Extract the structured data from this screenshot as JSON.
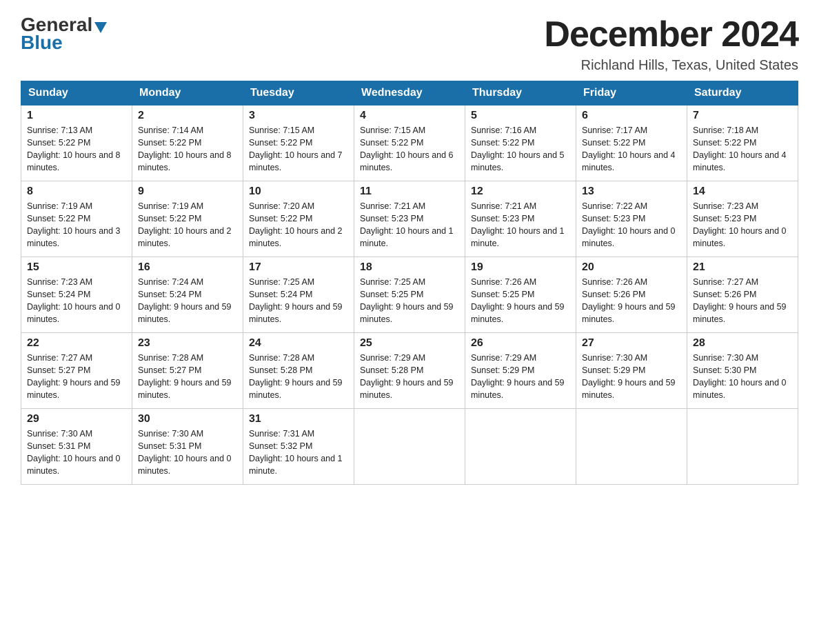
{
  "header": {
    "logo_general": "General",
    "logo_blue": "Blue",
    "title": "December 2024",
    "subtitle": "Richland Hills, Texas, United States"
  },
  "days_of_week": [
    "Sunday",
    "Monday",
    "Tuesday",
    "Wednesday",
    "Thursday",
    "Friday",
    "Saturday"
  ],
  "weeks": [
    [
      {
        "day": "1",
        "sunrise": "7:13 AM",
        "sunset": "5:22 PM",
        "daylight": "10 hours and 8 minutes."
      },
      {
        "day": "2",
        "sunrise": "7:14 AM",
        "sunset": "5:22 PM",
        "daylight": "10 hours and 8 minutes."
      },
      {
        "day": "3",
        "sunrise": "7:15 AM",
        "sunset": "5:22 PM",
        "daylight": "10 hours and 7 minutes."
      },
      {
        "day": "4",
        "sunrise": "7:15 AM",
        "sunset": "5:22 PM",
        "daylight": "10 hours and 6 minutes."
      },
      {
        "day": "5",
        "sunrise": "7:16 AM",
        "sunset": "5:22 PM",
        "daylight": "10 hours and 5 minutes."
      },
      {
        "day": "6",
        "sunrise": "7:17 AM",
        "sunset": "5:22 PM",
        "daylight": "10 hours and 4 minutes."
      },
      {
        "day": "7",
        "sunrise": "7:18 AM",
        "sunset": "5:22 PM",
        "daylight": "10 hours and 4 minutes."
      }
    ],
    [
      {
        "day": "8",
        "sunrise": "7:19 AM",
        "sunset": "5:22 PM",
        "daylight": "10 hours and 3 minutes."
      },
      {
        "day": "9",
        "sunrise": "7:19 AM",
        "sunset": "5:22 PM",
        "daylight": "10 hours and 2 minutes."
      },
      {
        "day": "10",
        "sunrise": "7:20 AM",
        "sunset": "5:22 PM",
        "daylight": "10 hours and 2 minutes."
      },
      {
        "day": "11",
        "sunrise": "7:21 AM",
        "sunset": "5:23 PM",
        "daylight": "10 hours and 1 minute."
      },
      {
        "day": "12",
        "sunrise": "7:21 AM",
        "sunset": "5:23 PM",
        "daylight": "10 hours and 1 minute."
      },
      {
        "day": "13",
        "sunrise": "7:22 AM",
        "sunset": "5:23 PM",
        "daylight": "10 hours and 0 minutes."
      },
      {
        "day": "14",
        "sunrise": "7:23 AM",
        "sunset": "5:23 PM",
        "daylight": "10 hours and 0 minutes."
      }
    ],
    [
      {
        "day": "15",
        "sunrise": "7:23 AM",
        "sunset": "5:24 PM",
        "daylight": "10 hours and 0 minutes."
      },
      {
        "day": "16",
        "sunrise": "7:24 AM",
        "sunset": "5:24 PM",
        "daylight": "9 hours and 59 minutes."
      },
      {
        "day": "17",
        "sunrise": "7:25 AM",
        "sunset": "5:24 PM",
        "daylight": "9 hours and 59 minutes."
      },
      {
        "day": "18",
        "sunrise": "7:25 AM",
        "sunset": "5:25 PM",
        "daylight": "9 hours and 59 minutes."
      },
      {
        "day": "19",
        "sunrise": "7:26 AM",
        "sunset": "5:25 PM",
        "daylight": "9 hours and 59 minutes."
      },
      {
        "day": "20",
        "sunrise": "7:26 AM",
        "sunset": "5:26 PM",
        "daylight": "9 hours and 59 minutes."
      },
      {
        "day": "21",
        "sunrise": "7:27 AM",
        "sunset": "5:26 PM",
        "daylight": "9 hours and 59 minutes."
      }
    ],
    [
      {
        "day": "22",
        "sunrise": "7:27 AM",
        "sunset": "5:27 PM",
        "daylight": "9 hours and 59 minutes."
      },
      {
        "day": "23",
        "sunrise": "7:28 AM",
        "sunset": "5:27 PM",
        "daylight": "9 hours and 59 minutes."
      },
      {
        "day": "24",
        "sunrise": "7:28 AM",
        "sunset": "5:28 PM",
        "daylight": "9 hours and 59 minutes."
      },
      {
        "day": "25",
        "sunrise": "7:29 AM",
        "sunset": "5:28 PM",
        "daylight": "9 hours and 59 minutes."
      },
      {
        "day": "26",
        "sunrise": "7:29 AM",
        "sunset": "5:29 PM",
        "daylight": "9 hours and 59 minutes."
      },
      {
        "day": "27",
        "sunrise": "7:30 AM",
        "sunset": "5:29 PM",
        "daylight": "9 hours and 59 minutes."
      },
      {
        "day": "28",
        "sunrise": "7:30 AM",
        "sunset": "5:30 PM",
        "daylight": "10 hours and 0 minutes."
      }
    ],
    [
      {
        "day": "29",
        "sunrise": "7:30 AM",
        "sunset": "5:31 PM",
        "daylight": "10 hours and 0 minutes."
      },
      {
        "day": "30",
        "sunrise": "7:30 AM",
        "sunset": "5:31 PM",
        "daylight": "10 hours and 0 minutes."
      },
      {
        "day": "31",
        "sunrise": "7:31 AM",
        "sunset": "5:32 PM",
        "daylight": "10 hours and 1 minute."
      },
      null,
      null,
      null,
      null
    ]
  ]
}
